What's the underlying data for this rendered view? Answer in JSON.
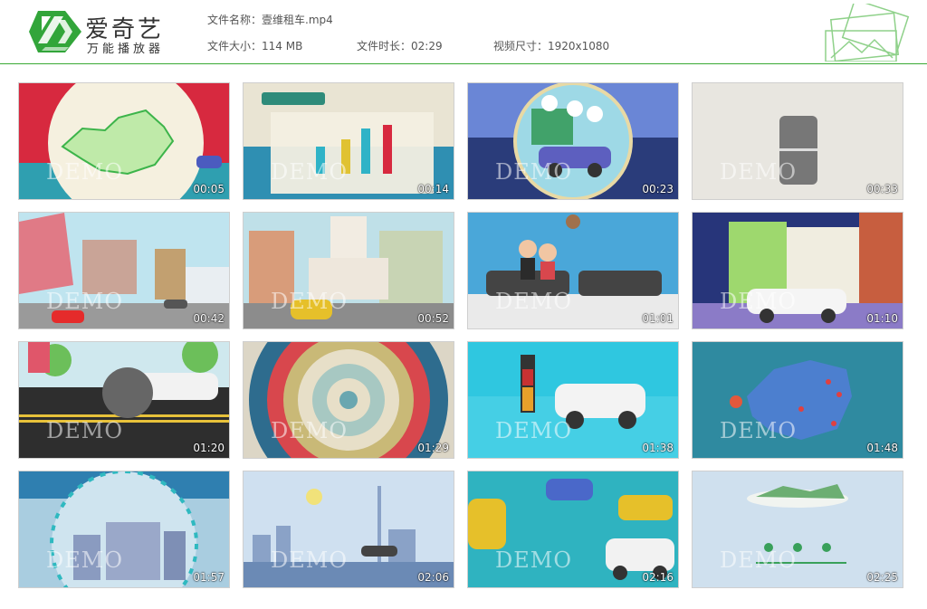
{
  "brand": {
    "title": "爱奇艺",
    "subtitle": "万能播放器",
    "accent": "#3aaa35"
  },
  "file": {
    "name_label": "文件名称：",
    "name": "壹维租车.mp4",
    "size_label": "文件大小：",
    "size": "114 MB",
    "duration_label": "文件时长：",
    "duration": "02:29",
    "resolution_label": "视频尺寸：",
    "resolution": "1920x1080"
  },
  "watermark": "DEMO",
  "thumbnails": [
    {
      "time": "00:05",
      "icon": "china-map-scene"
    },
    {
      "time": "00:14",
      "icon": "bar-chart-scene"
    },
    {
      "time": "00:23",
      "icon": "car-circle-scene"
    },
    {
      "time": "00:33",
      "icon": "phone-scene"
    },
    {
      "time": "00:42",
      "icon": "street-scene"
    },
    {
      "time": "00:52",
      "icon": "church-scene"
    },
    {
      "time": "01:01",
      "icon": "couple-scene"
    },
    {
      "time": "01:10",
      "icon": "building-car-scene"
    },
    {
      "time": "01:20",
      "icon": "road-car-scene"
    },
    {
      "time": "01:29",
      "icon": "target-scene"
    },
    {
      "time": "01:38",
      "icon": "battery-car-scene"
    },
    {
      "time": "01:48",
      "icon": "map-pins-scene"
    },
    {
      "time": "01:57",
      "icon": "city-circle-scene"
    },
    {
      "time": "02:06",
      "icon": "skyline-scene"
    },
    {
      "time": "02:16",
      "icon": "cars-scene"
    },
    {
      "time": "02:25",
      "icon": "island-scene"
    }
  ]
}
